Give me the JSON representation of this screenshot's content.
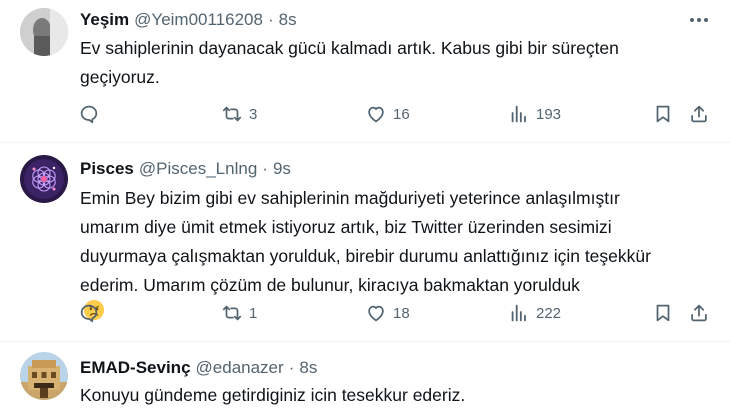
{
  "tweets": [
    {
      "name": "Yeşim",
      "handle": "@Yeim00116208",
      "separator": "·",
      "time": "8s",
      "lines": [
        "Ev sahiplerinin dayanacak gücü kalmadı artık. Kabus gibi bir süreçten",
        "geçiyoruz."
      ],
      "retweets": "3",
      "likes": "16",
      "views": "193"
    },
    {
      "name": "Pisces",
      "handle": "@Pisces_Lnlng",
      "separator": "·",
      "time": "9s",
      "lines": [
        "Emin Bey bizim gibi ev sahiplerinin mağduriyeti yeterince anlaşılmıştır",
        "umarım diye ümit etmek istiyoruz artık, biz Twitter üzerinden sesimizi",
        "duyurmaya çalışmaktan yorulduk, birebir durumu anlattığınız için teşekkür",
        "ederim. Umarım çözüm de bulunur, kiracıya bakmaktan yorulduk"
      ],
      "emoji": "disappointed-face",
      "retweets": "1",
      "likes": "18",
      "views": "222"
    },
    {
      "name": "EMAD-Sevinç",
      "handle": "@edanazer",
      "separator": "·",
      "time": "8s",
      "lines": [
        "Konuyu gündeme getirdiginiz icin tesekkur ederiz."
      ]
    }
  ],
  "icons": {
    "reply": "reply-icon",
    "retweet": "retweet-icon",
    "like": "heart-icon",
    "views": "views-chart-icon",
    "bookmark": "bookmark-icon",
    "share": "share-icon",
    "more": "more-icon"
  },
  "colors": {
    "text": "#0f1419",
    "muted": "#536471",
    "divider": "#eff3f4"
  }
}
